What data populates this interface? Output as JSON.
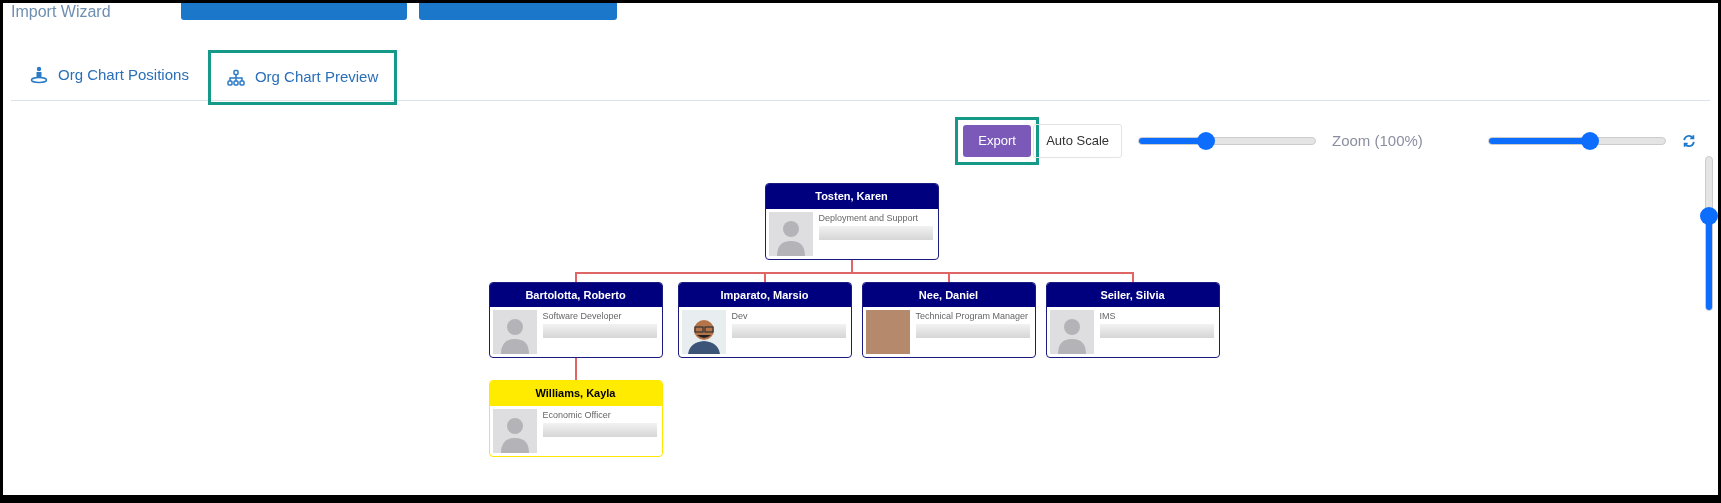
{
  "header": {
    "title": "Import Wizard",
    "buttons": [
      {
        "kind": "import"
      },
      {
        "kind": "import"
      }
    ]
  },
  "tabs": [
    {
      "label": "Org Chart Positions",
      "kind": "person",
      "selected": false
    },
    {
      "label": "Org Chart Preview",
      "kind": "hierarchy",
      "selected": true
    }
  ],
  "toolbar": {
    "export": {
      "label": "Export",
      "focused": true
    },
    "auto_scale": {
      "label": "Auto Scale"
    },
    "zoom_slider": {
      "level": 0.37
    },
    "zoom_label": "Zoom (100%)",
    "second_slider": {
      "level": 0.58
    },
    "vertical_slider": {
      "level": 0.63
    }
  },
  "org_chart": {
    "name": "Tosten, Karen",
    "title": "Deployment and Support",
    "kind": "silhouette",
    "highlighted": false,
    "children": [
      {
        "name": "Bartolotta, Roberto",
        "title": "Software Developer",
        "kind": "silhouette",
        "highlighted": false,
        "children": [
          {
            "name": "Williams, Kayla",
            "title": "Economic Officer",
            "kind": "silhouette",
            "highlighted": true
          }
        ]
      },
      {
        "name": "Imparato, Marsio",
        "title": "Dev",
        "kind": "cartoon",
        "highlighted": false
      },
      {
        "name": "Nee, Daniel",
        "title": "Technical Program Manager",
        "kind": "photo",
        "highlighted": false
      },
      {
        "name": "Seiler, Silvia",
        "title": "IMS",
        "kind": "silhouette",
        "highlighted": false
      }
    ]
  }
}
